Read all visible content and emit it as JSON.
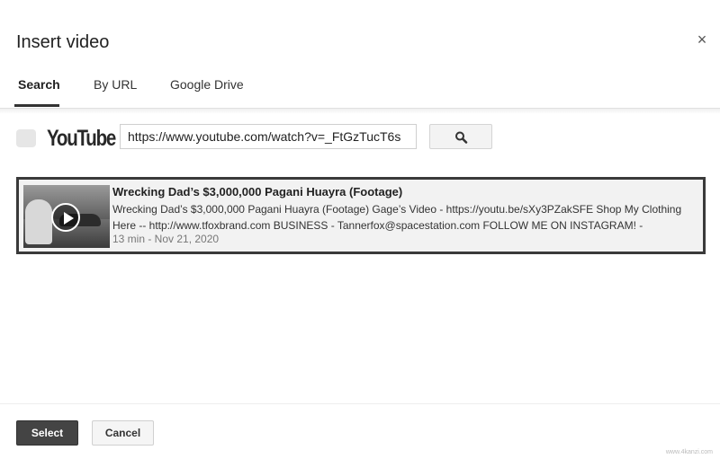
{
  "dialog": {
    "title": "Insert video",
    "close_glyph": "×"
  },
  "tabs": [
    {
      "label": "Search",
      "active": true
    },
    {
      "label": "By URL",
      "active": false
    },
    {
      "label": "Google Drive",
      "active": false
    }
  ],
  "search": {
    "brand": "YouTube",
    "url_value": "https://www.youtube.com/watch?v=_FtGzTucT6s",
    "button_icon": "search-icon"
  },
  "result": {
    "title": "Wrecking Dad’s $3,000,000 Pagani Huayra (Footage)",
    "description": "Wrecking Dad’s $3,000,000 Pagani Huayra (Footage) Gage’s Video - https://youtu.be/sXy3PZakSFE Shop My Clothing Here -- http://www.tfoxbrand.com BUSINESS - Tannerfox@spacestation.com FOLLOW ME ON INSTAGRAM! -",
    "meta": "13 min - Nov 21, 2020",
    "thumbnail_icon": "play-icon"
  },
  "footer": {
    "select_label": "Select",
    "cancel_label": "Cancel"
  },
  "watermark": "www.4kanzi.com",
  "colors": {
    "primary_button": "#444444",
    "selected_border": "#3a3a3a",
    "active_tab_underline": "#333333"
  }
}
